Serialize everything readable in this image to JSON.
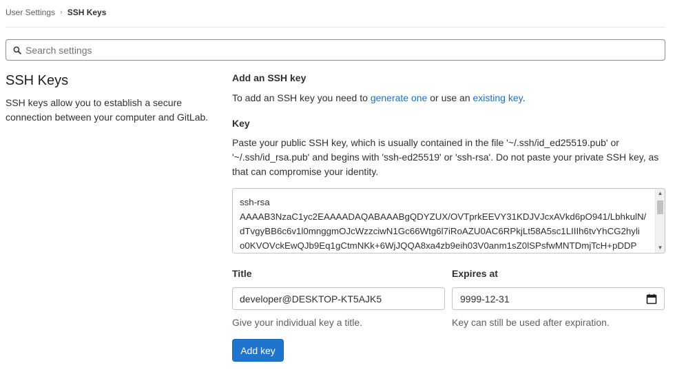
{
  "breadcrumb": {
    "parent": "User Settings",
    "separator": "›",
    "current": "SSH Keys"
  },
  "search": {
    "placeholder": "Search settings",
    "value": ""
  },
  "sidebar": {
    "title": "SSH Keys",
    "description": "SSH keys allow you to establish a secure connection between your computer and GitLab."
  },
  "form": {
    "heading": "Add an SSH key",
    "intro": {
      "prefix": "To add an SSH key you need to ",
      "link1": "generate one",
      "middle": " or use an ",
      "link2": "existing key",
      "suffix": "."
    },
    "key": {
      "label": "Key",
      "help": "Paste your public SSH key, which is usually contained in the file '~/.ssh/id_ed25519.pub' or '~/.ssh/id_rsa.pub' and begins with 'ssh-ed25519' or 'ssh-rsa'. Do not paste your private SSH key, as that can compromise your identity.",
      "value": "ssh-rsa\nAAAAB3NzaC1yc2EAAAADAQABAAABgQDYZUX/OVTprkEEVY31KDJVJcxAVkd6pO941/LbhkulN/\ndTvgyBB6c6v1l0mnggmOJcWzzciwN1Gc66Wtg6l7iRoAZU0AC6RPkjLt58A5sc1LIIIh6tvYhCG2hyli\no0KVOVckEwQJb9Eq1gCtmNKk+6WjJQQA8xa4zb9eih03V0anm1sZ0lSPsfwMNTDmjTcH+pDDP"
    },
    "title_field": {
      "label": "Title",
      "value": "developer@DESKTOP-KT5AJK5",
      "help": "Give your individual key a title."
    },
    "expires_field": {
      "label": "Expires at",
      "value": "9999-12-31",
      "help": "Key can still be used after expiration."
    },
    "submit_label": "Add key"
  },
  "colors": {
    "accent": "#1f75cb",
    "link": "#1f6fbf",
    "border": "#c4c4c4"
  }
}
